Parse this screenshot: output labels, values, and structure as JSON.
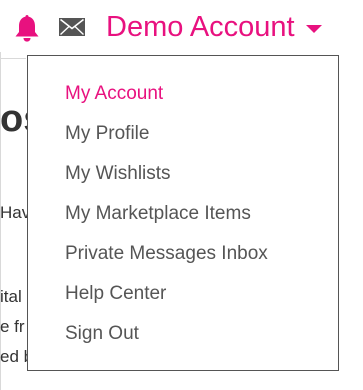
{
  "colors": {
    "accent": "#e8117f",
    "menu_text": "#555555",
    "menu_border": "#555555",
    "icon_gray": "#555555"
  },
  "header": {
    "notification_icon": "bell-icon",
    "messages_icon": "envelope-icon",
    "account_label": "Demo Account",
    "account_caret_icon": "caret-down-icon"
  },
  "background": {
    "heading_fragment": "os",
    "line_fragments": [
      "Hav",
      "ital",
      "e fr",
      "ed b"
    ]
  },
  "menu": {
    "items": [
      {
        "label": "My Account",
        "active": true
      },
      {
        "label": "My Profile",
        "active": false
      },
      {
        "label": "My Wishlists",
        "active": false
      },
      {
        "label": "My Marketplace Items",
        "active": false
      },
      {
        "label": "Private Messages Inbox",
        "active": false
      },
      {
        "label": "Help Center",
        "active": false
      },
      {
        "label": "Sign Out",
        "active": false
      }
    ]
  }
}
